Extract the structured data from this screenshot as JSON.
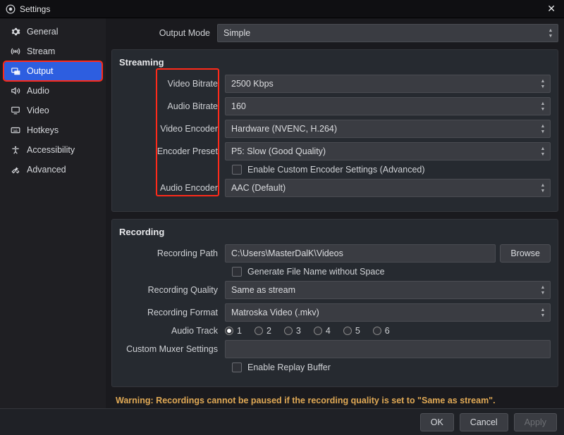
{
  "window": {
    "title": "Settings"
  },
  "sidebar": {
    "items": [
      {
        "label": "General"
      },
      {
        "label": "Stream"
      },
      {
        "label": "Output"
      },
      {
        "label": "Audio"
      },
      {
        "label": "Video"
      },
      {
        "label": "Hotkeys"
      },
      {
        "label": "Accessibility"
      },
      {
        "label": "Advanced"
      }
    ]
  },
  "output_mode": {
    "label": "Output Mode",
    "value": "Simple"
  },
  "streaming": {
    "title": "Streaming",
    "video_bitrate": {
      "label": "Video Bitrate",
      "value": "2500 Kbps"
    },
    "audio_bitrate": {
      "label": "Audio Bitrate",
      "value": "160"
    },
    "video_encoder": {
      "label": "Video Encoder",
      "value": "Hardware (NVENC, H.264)"
    },
    "encoder_preset": {
      "label": "Encoder Preset",
      "value": "P5: Slow (Good Quality)"
    },
    "custom_encoder_chk": {
      "label": "Enable Custom Encoder Settings (Advanced)"
    },
    "audio_encoder": {
      "label": "Audio Encoder",
      "value": "AAC (Default)"
    }
  },
  "recording": {
    "title": "Recording",
    "path": {
      "label": "Recording Path",
      "value": "C:\\Users\\MasterDalK\\Videos",
      "browse": "Browse"
    },
    "gen_filename_chk": {
      "label": "Generate File Name without Space"
    },
    "quality": {
      "label": "Recording Quality",
      "value": "Same as stream"
    },
    "format": {
      "label": "Recording Format",
      "value": "Matroska Video (.mkv)"
    },
    "audio_track": {
      "label": "Audio Track",
      "options": [
        "1",
        "2",
        "3",
        "4",
        "5",
        "6"
      ]
    },
    "muxer": {
      "label": "Custom Muxer Settings"
    },
    "replay_chk": {
      "label": "Enable Replay Buffer"
    }
  },
  "warning": "Warning: Recordings cannot be paused if the recording quality is set to \"Same as stream\".",
  "footer": {
    "ok": "OK",
    "cancel": "Cancel",
    "apply": "Apply"
  }
}
